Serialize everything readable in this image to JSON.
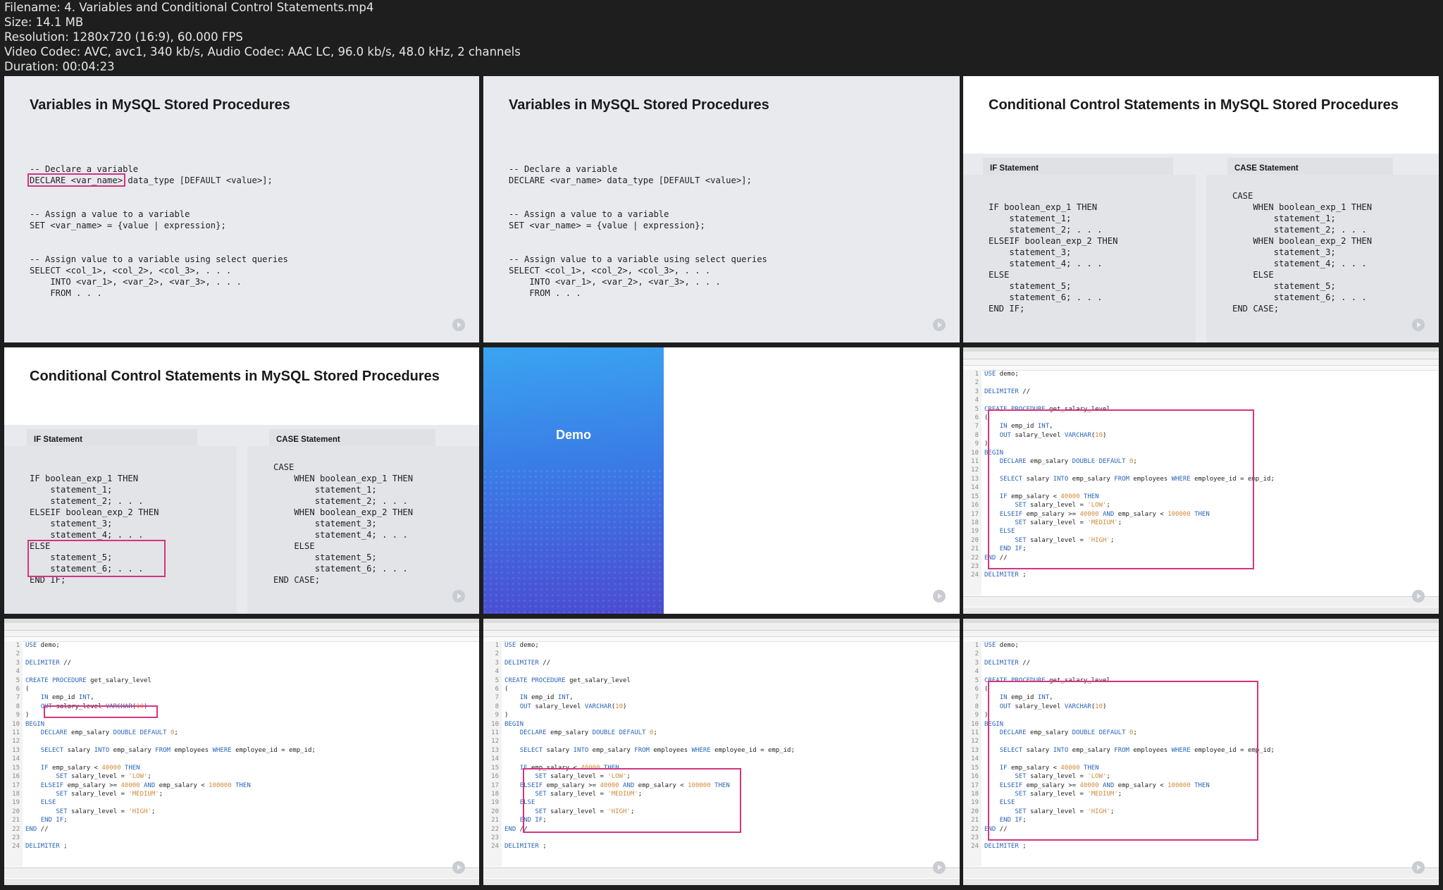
{
  "header": {
    "filename": "Filename: 4. Variables and Conditional Control Statements.mp4",
    "size": "Size: 14.1 MB",
    "resolution": "Resolution: 1280x720 (16:9), 60.000 FPS",
    "codec": "Video Codec: AVC, avc1, 340 kb/s, Audio Codec: AAC LC, 96.0 kb/s, 48.0 kHz, 2 channels",
    "duration": "Duration: 00:04:23"
  },
  "slides": {
    "variables_title": "Variables in MySQL Stored Procedures",
    "variables_code": "-- Declare a variable\nDECLARE <var_name> data_type [DEFAULT <value>];\n\n\n-- Assign a value to a variable\nSET <var_name> = {value | expression};\n\n\n-- Assign value to a variable using select queries\nSELECT <col_1>, <col_2>, <col_3>, . . .\n    INTO <var_1>, <var_2>, <var_3>, . . .\n    FROM . . .",
    "conditional_title": "Conditional Control Statements in MySQL Stored Procedures",
    "if_label": "IF Statement",
    "case_label": "CASE Statement",
    "if_code": "IF boolean_exp_1 THEN\n    statement_1;\n    statement_2; . . .\nELSEIF boolean_exp_2 THEN\n    statement_3;\n    statement_4; . . .\nELSE\n    statement_5;\n    statement_6; . . .\nEND IF;",
    "case_code": "CASE\n    WHEN boolean_exp_1 THEN\n        statement_1;\n        statement_2; . . .\n    WHEN boolean_exp_2 THEN\n        statement_3;\n        statement_4; . . .\n    ELSE\n        statement_5;\n        statement_6; . . .\nEND CASE;",
    "demo_label": "Demo"
  },
  "ide": {
    "lines": [
      "USE demo;",
      "",
      "DELIMITER //",
      "",
      "CREATE PROCEDURE get_salary_level",
      "(",
      "    IN emp_id INT,",
      "    OUT salary_level VARCHAR(10)",
      ")",
      "BEGIN",
      "    DECLARE emp_salary DOUBLE DEFAULT 0;",
      "",
      "    SELECT salary INTO emp_salary FROM employees WHERE employee_id = emp_id;",
      "",
      "    IF emp_salary < 40000 THEN",
      "        SET salary_level = 'LOW';",
      "    ELSEIF emp_salary >= 40000 AND emp_salary < 100000 THEN",
      "        SET salary_level = 'MEDIUM';",
      "    ELSE",
      "        SET salary_level = 'HIGH';",
      "    END IF;",
      "END //",
      "",
      "DELIMITER ;"
    ]
  }
}
